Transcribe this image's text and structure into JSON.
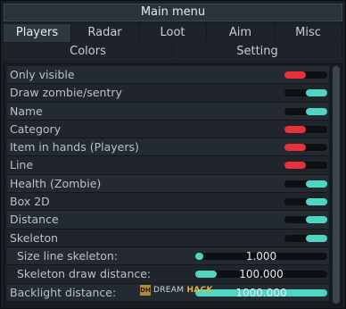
{
  "window": {
    "title": "Main menu"
  },
  "tabs": [
    {
      "label": "Players",
      "active": true
    },
    {
      "label": "Radar",
      "active": false
    },
    {
      "label": "Loot",
      "active": false
    },
    {
      "label": "Aim",
      "active": false
    },
    {
      "label": "Misc",
      "active": false
    }
  ],
  "subtabs": [
    {
      "label": "Colors"
    },
    {
      "label": "Setting"
    }
  ],
  "options": [
    {
      "label": "Only visible",
      "enabled": false
    },
    {
      "label": "Draw zombie/sentry",
      "enabled": true
    },
    {
      "label": "Name",
      "enabled": true
    },
    {
      "label": "Category",
      "enabled": false
    },
    {
      "label": "Item in hands (Players)",
      "enabled": false
    },
    {
      "label": "Line",
      "enabled": false
    },
    {
      "label": "Health (Zombie)",
      "enabled": true
    },
    {
      "label": "Box 2D",
      "enabled": true
    },
    {
      "label": "Distance",
      "enabled": true
    },
    {
      "label": "Skeleton",
      "enabled": true
    }
  ],
  "sliders": [
    {
      "label": "Size line skeleton:",
      "value": "1.000",
      "fill_fraction": 0.06
    },
    {
      "label": "Skeleton draw distance:",
      "value": "100.000",
      "fill_fraction": 0.16
    },
    {
      "label": "Backlight distance:",
      "value": "1000.000",
      "fill_fraction": 1.0
    }
  ],
  "watermark": {
    "logo": "DH",
    "brand_a": "DREAM",
    "brand_b": "HACK"
  },
  "colors": {
    "toggle_on": "#4fd6c2",
    "toggle_off": "#e8313a",
    "accent": "#4fd6c2"
  }
}
